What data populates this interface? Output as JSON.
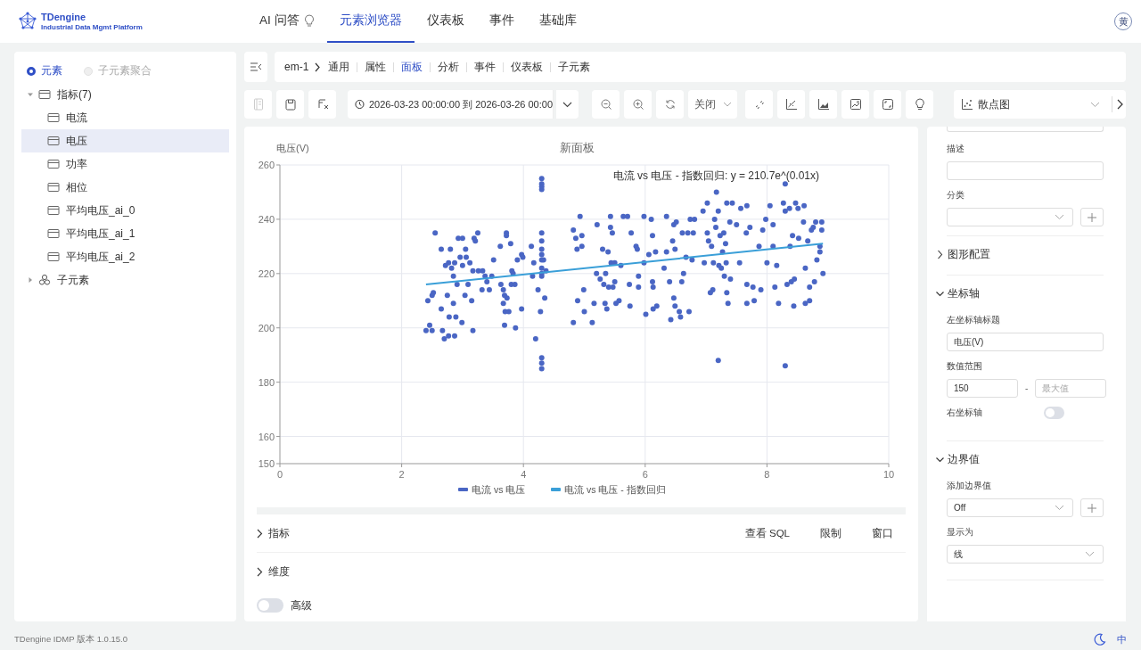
{
  "header": {
    "logo": {
      "name": "TDengine",
      "tagline": "Industrial Data Mgmt Platform"
    },
    "nav": [
      {
        "label": "AI 问答",
        "kind": "assistant",
        "selected": false
      },
      {
        "label": "元素浏览器",
        "kind": "page",
        "selected": true
      },
      {
        "label": "仪表板",
        "kind": "page",
        "selected": false
      },
      {
        "label": "事件",
        "kind": "page",
        "selected": false
      },
      {
        "label": "基础库",
        "kind": "page",
        "selected": false
      }
    ],
    "avatar": "黄"
  },
  "sidebar": {
    "modes": [
      {
        "label": "元素",
        "selected": true,
        "disabled": false
      },
      {
        "label": "子元素聚合",
        "selected": false,
        "disabled": true
      }
    ],
    "tree": [
      {
        "label": "指标(7)",
        "kind": "metric-group",
        "expanded": true,
        "selected": false,
        "children": [
          {
            "label": "电流",
            "kind": "metric",
            "selected": false
          },
          {
            "label": "电压",
            "kind": "metric",
            "selected": true
          },
          {
            "label": "功率",
            "kind": "metric",
            "selected": false
          },
          {
            "label": "相位",
            "kind": "metric",
            "selected": false
          },
          {
            "label": "平均电压_ai_0",
            "kind": "metric",
            "selected": false
          },
          {
            "label": "平均电压_ai_1",
            "kind": "metric",
            "selected": false
          },
          {
            "label": "平均电压_ai_2",
            "kind": "metric",
            "selected": false
          }
        ]
      },
      {
        "label": "子元素",
        "kind": "element-group",
        "expanded": false,
        "selected": false
      }
    ]
  },
  "breadcrumb": {
    "element": "em-1",
    "tabs": [
      {
        "label": "通用",
        "selected": false
      },
      {
        "label": "属性",
        "selected": false
      },
      {
        "label": "面板",
        "selected": true
      },
      {
        "label": "分析",
        "selected": false
      },
      {
        "label": "事件",
        "selected": false
      },
      {
        "label": "仪表板",
        "selected": false
      },
      {
        "label": "子元素",
        "selected": false
      }
    ]
  },
  "toolbar": {
    "file_buttons": [
      {
        "disabled": true
      },
      {
        "disabled": false
      },
      {
        "disabled": false
      }
    ],
    "time_range": "2026-03-23 00:00:00 到 2026-03-26 00:00",
    "refresh": "关闭",
    "chart_type": "散点图"
  },
  "panel": {
    "chart_data": {
      "type": "scatter",
      "grid": true,
      "legend": "bottom",
      "title": "新面板",
      "ylabel": "电压(V)",
      "xlim": [
        0,
        10
      ],
      "ylim": [
        150,
        260
      ],
      "xticks": [
        0,
        2,
        4,
        6,
        8,
        10
      ],
      "yticks": [
        150,
        160,
        180,
        200,
        220,
        240,
        260
      ],
      "annotations": [
        "电流 vs 电压 - 指数回归: y = 210.7e^(0.01x)"
      ],
      "x": [
        2.4,
        2.43,
        2.46,
        2.5,
        2.5,
        2.52,
        2.55,
        2.65,
        2.65,
        2.67,
        2.7,
        2.72,
        2.75,
        2.77,
        2.78,
        2.77,
        2.8,
        2.82,
        2.85,
        2.85,
        2.87,
        2.89,
        2.87,
        2.91,
        2.93,
        2.96,
        2.99,
        3.0,
        3.0,
        3.04,
        3.05,
        3.06,
        3.09,
        3.12,
        3.15,
        3.17,
        3.17,
        3.19,
        3.21,
        3.25,
        3.26,
        3.32,
        3.33,
        3.37,
        3.4,
        3.44,
        3.48,
        3.51,
        3.62,
        3.63,
        3.67,
        3.67,
        3.69,
        3.69,
        3.7,
        3.72,
        3.72,
        3.73,
        3.76,
        3.79,
        3.8,
        3.81,
        3.83,
        3.86,
        3.87,
        3.9,
        3.97,
        3.97,
        3.99,
        4.13,
        4.15,
        4.17,
        4.2,
        4.24,
        4.28,
        4.3,
        4.3,
        4.3,
        4.3,
        4.3,
        4.3,
        4.3,
        4.3,
        4.3,
        4.3,
        4.3,
        4.3,
        4.3,
        4.3,
        4.3,
        4.33,
        4.35,
        4.37,
        4.82,
        4.82,
        4.86,
        4.88,
        4.89,
        4.93,
        4.96,
        4.96,
        4.99,
        5.0,
        5.13,
        5.16,
        5.2,
        5.21,
        5.26,
        5.3,
        5.32,
        5.34,
        5.35,
        5.37,
        5.39,
        5.4,
        5.43,
        5.43,
        5.44,
        5.46,
        5.47,
        5.5,
        5.5,
        5.52,
        5.57,
        5.6,
        5.64,
        5.71,
        5.74,
        5.75,
        5.77,
        5.85,
        5.87,
        5.89,
        5.89,
        5.98,
        5.98,
        6.01,
        6.06,
        6.1,
        6.12,
        6.12,
        6.13,
        6.13,
        6.17,
        6.19,
        6.31,
        6.35,
        6.35,
        6.4,
        6.42,
        6.45,
        6.47,
        6.49,
        6.51,
        6.47,
        6.49,
        6.56,
        6.58,
        6.6,
        6.61,
        6.63,
        6.67,
        6.7,
        6.72,
        6.74,
        6.77,
        6.79,
        6.81,
        6.95,
        6.97,
        7.02,
        7.02,
        7.04,
        7.07,
        7.09,
        7.11,
        7.12,
        7.14,
        7.16,
        7.17,
        7.2,
        7.2,
        7.21,
        7.23,
        7.25,
        7.27,
        7.29,
        7.3,
        7.32,
        7.33,
        7.34,
        7.36,
        7.34,
        7.39,
        7.4,
        7.43,
        7.5,
        7.55,
        7.57,
        7.66,
        7.67,
        7.67,
        7.67,
        7.72,
        7.77,
        7.79,
        7.87,
        7.9,
        7.93,
        7.98,
        8.0,
        8.05,
        8.1,
        8.1,
        8.13,
        8.16,
        8.19,
        8.27,
        8.3,
        8.3,
        8.3,
        8.33,
        8.37,
        8.38,
        8.4,
        8.42,
        8.44,
        8.45,
        8.47,
        8.51,
        8.52,
        8.61,
        8.63,
        8.63,
        8.6,
        8.67,
        8.7,
        8.7,
        8.73,
        8.76,
        8.78,
        8.8,
        8.82,
        8.87,
        8.87,
        8.9,
        8.9,
        8.92
      ],
      "series": [
        {
          "name": "电流 vs 电压",
          "color": "#4a66c4",
          "type": "scatter",
          "values": [
            199,
            210,
            201,
            199,
            212,
            213,
            235,
            229,
            207,
            199,
            196,
            223,
            212,
            224,
            204,
            197,
            229,
            222,
            219,
            209,
            224,
            204,
            197,
            216,
            233,
            226,
            202,
            233,
            223,
            212,
            229,
            226,
            216,
            224,
            210,
            199,
            221,
            233,
            232,
            235,
            221,
            214,
            221,
            219,
            217,
            214,
            219,
            225,
            230,
            216,
            214,
            209,
            212,
            201,
            206,
            235,
            234,
            211,
            206,
            231,
            216,
            221,
            220,
            216,
            200,
            225,
            227,
            207,
            226,
            230,
            219,
            224,
            196,
            214,
            206,
            255,
            253,
            252,
            251,
            235,
            232,
            229,
            227,
            225,
            222,
            220,
            219,
            189,
            187,
            185,
            225,
            211,
            221,
            236,
            202,
            233,
            229,
            210,
            241,
            234,
            230,
            214,
            206,
            202,
            209,
            220,
            238,
            218,
            229,
            216,
            209,
            220,
            207,
            228,
            215,
            237,
            241,
            224,
            235,
            215,
            217,
            224,
            209,
            210,
            223,
            241,
            241,
            216,
            208,
            235,
            230,
            229,
            219,
            215,
            224,
            241,
            205,
            227,
            240,
            217,
            234,
            215,
            207,
            228,
            208,
            222,
            228,
            241,
            217,
            203,
            232,
            238,
            229,
            239,
            211,
            208,
            206,
            204,
            217,
            235,
            220,
            226,
            235,
            206,
            240,
            225,
            235,
            240,
            243,
            224,
            246,
            235,
            232,
            213,
            230,
            214,
            224,
            240,
            237,
            250,
            188,
            243,
            223,
            234,
            222,
            228,
            235,
            219,
            231,
            224,
            213,
            209,
            246,
            239,
            218,
            246,
            238,
            224,
            244,
            235,
            245,
            216,
            209,
            237,
            215,
            210,
            230,
            214,
            236,
            240,
            224,
            245,
            238,
            230,
            215,
            223,
            209,
            246,
            253,
            243,
            186,
            216,
            244,
            230,
            217,
            234,
            208,
            218,
            246,
            244,
            233,
            245,
            222,
            209,
            239,
            232,
            215,
            210,
            236,
            237,
            217,
            239,
            225,
            228,
            230,
            236,
            239,
            220
          ]
        },
        {
          "name": "电流 vs 电压 - 指数回归",
          "color": "#3a9fd8",
          "type": "line",
          "values": [
            216,
            null,
            null,
            null,
            null,
            null,
            null,
            null,
            null,
            null,
            null,
            null,
            null,
            null,
            null,
            null,
            null,
            null,
            null,
            null,
            null,
            null,
            null,
            null,
            null,
            null,
            null,
            null,
            null,
            null,
            null,
            null,
            null,
            null,
            null,
            null,
            null,
            null,
            null,
            null,
            null,
            null,
            null,
            null,
            null,
            null,
            null,
            null,
            null,
            null,
            null,
            null,
            null,
            null,
            null,
            null,
            null,
            null,
            null,
            null,
            null,
            null,
            null,
            null,
            null,
            null,
            null,
            null,
            null,
            null,
            null,
            null,
            null,
            null,
            null,
            null,
            null,
            null,
            null,
            null,
            null,
            null,
            null,
            null,
            null,
            null,
            null,
            null,
            null,
            null,
            null,
            null,
            null,
            null,
            null,
            null,
            null,
            null,
            null,
            null,
            null,
            null,
            null,
            null,
            null,
            null,
            null,
            null,
            null,
            null,
            null,
            null,
            null,
            null,
            null,
            null,
            null,
            null,
            null,
            null,
            null,
            null,
            null,
            null,
            null,
            null,
            null,
            null,
            null,
            null,
            null,
            null,
            null,
            null,
            null,
            null,
            null,
            null,
            null,
            null,
            null,
            null,
            null,
            null,
            null,
            null,
            null,
            null,
            null,
            null,
            null,
            null,
            null,
            null,
            null,
            null,
            null,
            null,
            null,
            null,
            null,
            null,
            null,
            null,
            null,
            null,
            null,
            null,
            null,
            null,
            null,
            null,
            null,
            null,
            null,
            null,
            null,
            null,
            null,
            null,
            null,
            null,
            null,
            null,
            null,
            null,
            null,
            null,
            null,
            null,
            null,
            null,
            null,
            null,
            null,
            null,
            null,
            null,
            null,
            null,
            null,
            null,
            null,
            null,
            null,
            null,
            null,
            null,
            null,
            null,
            null,
            null,
            null,
            null,
            null,
            null,
            null,
            null,
            null,
            null,
            null,
            null,
            null,
            null,
            null,
            null,
            null,
            null,
            null,
            null,
            null,
            null,
            null,
            null,
            null,
            null,
            null,
            null,
            null,
            null,
            null,
            null,
            null,
            null,
            null,
            null,
            null,
            231
          ]
        }
      ]
    },
    "sections": [
      {
        "label": "指标",
        "expanded": false,
        "actions": [
          "查看 SQL",
          "限制",
          "窗口"
        ]
      },
      {
        "label": "维度",
        "expanded": false
      }
    ],
    "advanced": {
      "label": "高级",
      "on": false
    }
  },
  "settings": [
    {
      "kind": "input",
      "label": "描述"
    },
    {
      "kind": "select",
      "label": "分类",
      "add": true
    },
    {
      "kind": "section",
      "label": "图形配置",
      "expanded": false
    },
    {
      "kind": "section",
      "label": "坐标轴",
      "expanded": true
    },
    {
      "kind": "input",
      "label": "左坐标轴标题",
      "value": "电压(V)"
    },
    {
      "kind": "range",
      "label": "数值范围",
      "min": "150",
      "separator": "-",
      "max_placeholder": "最大值"
    },
    {
      "kind": "toggle",
      "label": "右坐标轴",
      "on": false
    },
    {
      "kind": "section",
      "label": "边界值",
      "expanded": true
    },
    {
      "kind": "select",
      "label": "添加边界值",
      "value": "Off",
      "add": true
    },
    {
      "kind": "select",
      "label": "显示为",
      "value": "线",
      "add": false
    }
  ],
  "footer": {
    "version": "TDengine IDMP 版本 1.0.15.0",
    "language": "中"
  }
}
